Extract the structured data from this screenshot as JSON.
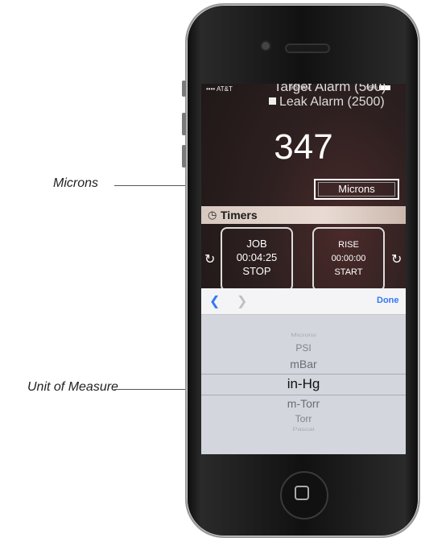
{
  "callouts": {
    "microns": "Microns",
    "unit_of_measure": "Unit of Measure"
  },
  "status_bar": {
    "carrier": "•••• AT&T",
    "time": "9:52 AM",
    "battery": "99%"
  },
  "alarms": {
    "top_alarm": "Target Alarm (500)",
    "leak_alarm": "Leak Alarm (2500)"
  },
  "reading": {
    "value": "347",
    "unit_button": "Microns"
  },
  "timers": {
    "title": "Timers",
    "job": {
      "name": "JOB",
      "time": "00:04:25",
      "action": "STOP"
    },
    "rise": {
      "name": "RISE",
      "time": "00:00:00",
      "action": "START"
    }
  },
  "picker": {
    "done_label": "Done",
    "options": [
      "Microns",
      "PSI",
      "mBar",
      "in-Hg",
      "m-Torr",
      "Torr",
      "Pascal"
    ],
    "selected": "in-Hg"
  },
  "colors": {
    "accent": "#3478f6",
    "timers_bar": "#e2d3ca",
    "picker_bg": "#d3d6dc"
  },
  "icons": {
    "reset": "reset-icon",
    "clock": "clock-icon",
    "prev": "chevron-left-icon",
    "next": "chevron-right-icon",
    "home": "home-button-icon"
  }
}
